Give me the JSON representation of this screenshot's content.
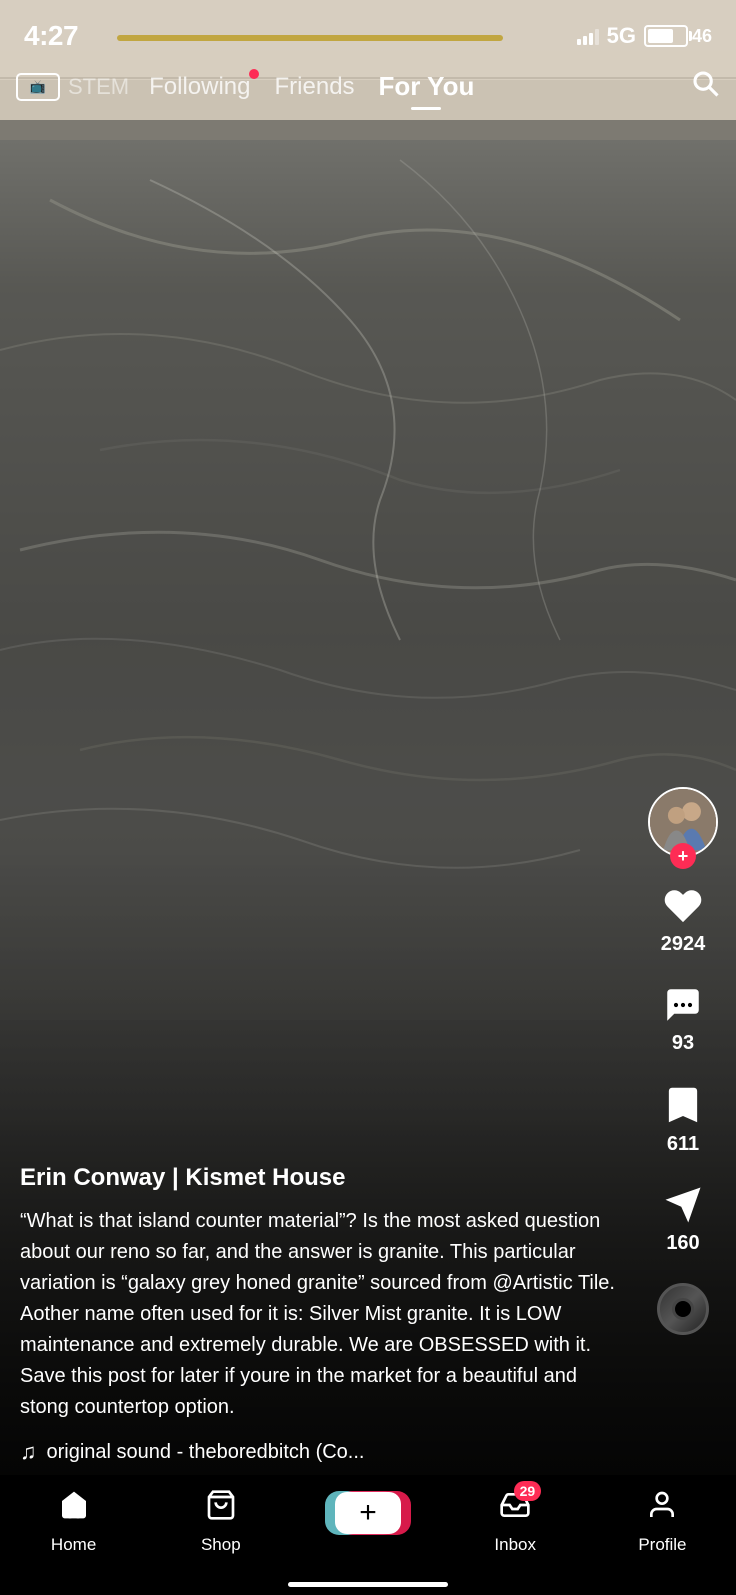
{
  "status": {
    "time": "4:27",
    "network": "5G",
    "battery": "46"
  },
  "nav": {
    "live_label": "LIVE",
    "stem_label": "STEM",
    "following_label": "Following",
    "friends_label": "Friends",
    "for_you_label": "For You"
  },
  "video": {
    "creator": "Erin Conway | Kismet House",
    "caption": "“What is that island counter material”? Is the most asked question about our reno so far, and the answer is granite. This particular variation is “galaxy grey honed granite” sourced from @Artistic Tile. Aother name often used for it is: Silver Mist granite.\nIt is LOW maintenance and extremely durable. We are OBSESSED with it. Save this post for later if youre in the market for a beautiful and stong countertop option.",
    "sound": "original sound - theboredbitch (Co...",
    "likes": "2924",
    "comments": "93",
    "bookmarks": "611",
    "shares": "160"
  },
  "bottom_nav": {
    "home_label": "Home",
    "shop_label": "Shop",
    "inbox_label": "Inbox",
    "inbox_count": "29",
    "profile_label": "Profile"
  }
}
